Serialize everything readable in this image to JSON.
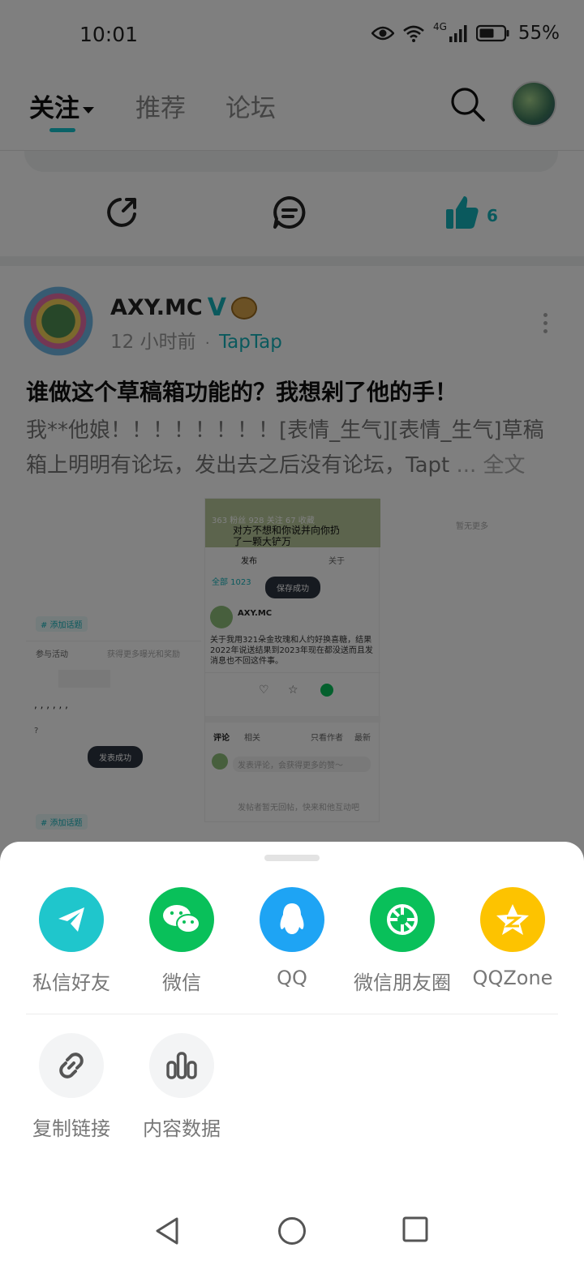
{
  "status_bar": {
    "time": "10:01",
    "network": "4G",
    "battery": "55%"
  },
  "top_nav": {
    "tabs": [
      {
        "label": "关注",
        "active": true
      },
      {
        "label": "推荐",
        "active": false
      },
      {
        "label": "论坛",
        "active": false
      }
    ],
    "icons": [
      "search-icon",
      "avatar"
    ]
  },
  "action_row": {
    "like_count": "6",
    "icons": [
      "share-icon",
      "comment-icon",
      "thumbs-up-icon"
    ]
  },
  "post": {
    "author": "AXY.MC",
    "verified_mark": "V",
    "time": "12 小时前",
    "dot": "·",
    "source": "TapTap",
    "title": "谁做这个草稿箱功能的？我想剁了他的手！",
    "body_line1": "我**他娘！！！！！！！！[表情_生气][表情_生气]草稿",
    "body_line2": "箱上明明有论坛，发出去之后没有论坛，Tapt",
    "ellipsis": "...",
    "full_text": "全文",
    "collage": {
      "tag_label": "# 添加话题",
      "activity": "参与活动",
      "activity_hint": "获得更多曝光和奖励",
      "text_cursor": ", , , , , ,",
      "question": "?",
      "publish_success": "发表成功",
      "tag_label_2": "# 添加话题",
      "stats": "363 粉丝   928 关注   67 收藏",
      "toast_line1": "对方不想和你说并向你扔",
      "toast_line2": "了一颗大铲万",
      "tab_publish": "发布",
      "tab_about": "关于",
      "tab_all": "全部 1023",
      "save_success": "保存成功",
      "mini_author": "AXY.MC",
      "mini_body": "关于我用321朵金玫瑰和人约好换喜糖，结果2022年说送结果到2023年现在都没送而且发消息也不回这件事。",
      "comments_tab": "评论",
      "related_tab": "相关",
      "only_author": "只看作者",
      "latest": "最新",
      "comment_placeholder": "发表评论，会获得更多的赞～",
      "empty_hint": "发帖者暂无回帖，快来和他互动吧",
      "more_hint": "暂无更多"
    }
  },
  "share_sheet": {
    "row1": [
      {
        "label": "私信好友",
        "icon": "paper-plane-icon",
        "color": "#1fc6cc"
      },
      {
        "label": "微信",
        "icon": "wechat-icon",
        "color": "#09c05a"
      },
      {
        "label": "QQ",
        "icon": "qq-penguin-icon",
        "color": "#1ea4f4"
      },
      {
        "label": "微信朋友圈",
        "icon": "moments-icon",
        "color": "#09c05a"
      },
      {
        "label": "QQZone",
        "icon": "qzone-star-icon",
        "color": "#fdc300"
      }
    ],
    "row2": [
      {
        "label": "复制链接",
        "icon": "link-icon",
        "color": "#f3f4f5"
      },
      {
        "label": "内容数据",
        "icon": "bar-chart-icon",
        "color": "#f3f4f5"
      }
    ]
  },
  "nav_bar": {
    "buttons": [
      "back-icon",
      "home-icon",
      "recents-icon"
    ]
  }
}
